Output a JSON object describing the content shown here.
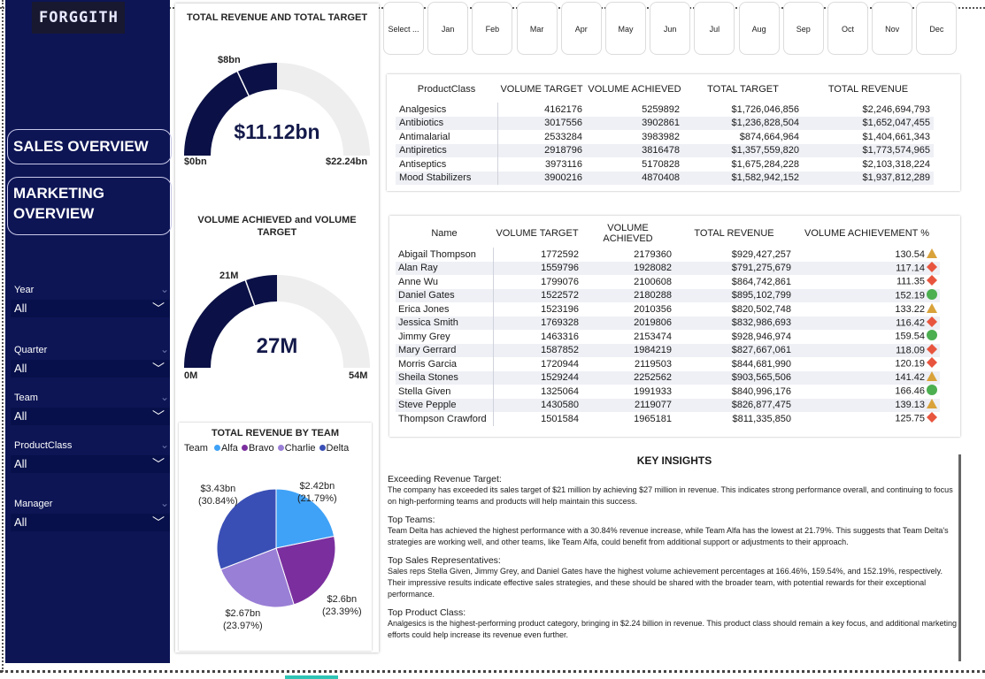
{
  "app": {
    "logo_text": "FORGGITH"
  },
  "nav": {
    "sales": "SALES OVERVIEW",
    "marketing": "MARKETING OVERVIEW"
  },
  "filters": [
    {
      "label": "Year",
      "value": "All"
    },
    {
      "label": "Quarter",
      "value": "All"
    },
    {
      "label": "Team",
      "value": "All"
    },
    {
      "label": "ProductClass",
      "value": "All"
    },
    {
      "label": "Manager",
      "value": "All"
    }
  ],
  "months": [
    "Select ...",
    "Jan",
    "Feb",
    "Mar",
    "Apr",
    "May",
    "Jun",
    "Jul",
    "Aug",
    "Sep",
    "Oct",
    "Nov",
    "Dec"
  ],
  "gauge1": {
    "title": "TOTAL REVENUE AND TOTAL TARGET",
    "value": "$11.12bn",
    "min": "$0bn",
    "max": "$22.24bn",
    "target": "$8bn",
    "fraction": 0.5,
    "target_fraction": 0.36
  },
  "gauge2": {
    "title": "VOLUME ACHIEVED and VOLUME TARGET",
    "value": "27M",
    "min": "0M",
    "max": "54M",
    "target": "21M",
    "fraction": 0.5,
    "target_fraction": 0.39
  },
  "pie": {
    "title": "TOTAL REVENUE BY TEAM",
    "legend_title": "Team",
    "labels": [
      {
        "value": "$2.42bn",
        "pct": "(21.79%)"
      },
      {
        "value": "$2.6bn",
        "pct": "(23.39%)"
      },
      {
        "value": "$2.67bn",
        "pct": "(23.97%)"
      },
      {
        "value": "$3.43bn",
        "pct": "(30.84%)"
      }
    ]
  },
  "chart_data": {
    "type": "pie",
    "title": "TOTAL REVENUE BY TEAM",
    "categories": [
      "Alfa",
      "Bravo",
      "Charlie",
      "Delta"
    ],
    "values": [
      2.42,
      2.6,
      2.67,
      3.43
    ],
    "percentages": [
      21.79,
      23.39,
      23.97,
      30.84
    ],
    "colors": [
      "#3fa2f7",
      "#7b2f9e",
      "#9a7fd6",
      "#3a4fb5"
    ]
  },
  "product_table": {
    "headers": [
      "ProductClass",
      "VOLUME TARGET",
      "VOLUME ACHIEVED",
      "TOTAL TARGET",
      "TOTAL REVENUE"
    ],
    "rows": [
      [
        "Analgesics",
        "4162176",
        "5259892",
        "$1,726,046,856",
        "$2,246,694,793"
      ],
      [
        "Antibiotics",
        "3017556",
        "3902861",
        "$1,236,828,504",
        "$1,652,047,455"
      ],
      [
        "Antimalarial",
        "2533284",
        "3983982",
        "$874,664,964",
        "$1,404,661,343"
      ],
      [
        "Antipiretics",
        "2918796",
        "3816478",
        "$1,357,559,820",
        "$1,773,574,965"
      ],
      [
        "Antiseptics",
        "3973116",
        "5170828",
        "$1,675,284,228",
        "$2,103,318,224"
      ],
      [
        "Mood Stabilizers",
        "3900216",
        "4870408",
        "$1,582,942,152",
        "$1,937,812,289"
      ]
    ]
  },
  "rep_table": {
    "headers": [
      "Name",
      "VOLUME TARGET",
      "VOLUME ACHIEVED",
      "TOTAL REVENUE",
      "VOLUME ACHIEVEMENT %"
    ],
    "rows": [
      [
        "Abigail Thompson",
        "1772592",
        "2179360",
        "$929,427,257",
        "130.54",
        "triangle"
      ],
      [
        "Alan Ray",
        "1559796",
        "1928082",
        "$791,275,679",
        "117.14",
        "diamond"
      ],
      [
        "Anne Wu",
        "1799076",
        "2100608",
        "$864,742,861",
        "111.35",
        "diamond"
      ],
      [
        "Daniel Gates",
        "1522572",
        "2180288",
        "$895,102,799",
        "152.19",
        "circle"
      ],
      [
        "Erica Jones",
        "1523196",
        "2010356",
        "$820,502,748",
        "133.22",
        "triangle"
      ],
      [
        "Jessica Smith",
        "1769328",
        "2019806",
        "$832,986,693",
        "116.42",
        "diamond"
      ],
      [
        "Jimmy Grey",
        "1463316",
        "2153474",
        "$928,946,974",
        "159.54",
        "circle"
      ],
      [
        "Mary Gerrard",
        "1587852",
        "1984219",
        "$827,667,061",
        "118.09",
        "diamond"
      ],
      [
        "Morris Garcia",
        "1720944",
        "2119503",
        "$844,681,990",
        "120.19",
        "diamond"
      ],
      [
        "Sheila Stones",
        "1529244",
        "2252562",
        "$903,565,506",
        "141.42",
        "triangle"
      ],
      [
        "Stella Given",
        "1325064",
        "1991933",
        "$840,996,176",
        "166.46",
        "circle"
      ],
      [
        "Steve Pepple",
        "1430580",
        "2119077",
        "$826,877,475",
        "139.13",
        "triangle"
      ],
      [
        "Thompson Crawford",
        "1501584",
        "1965181",
        "$811,335,850",
        "125.75",
        "diamond"
      ]
    ]
  },
  "insights": {
    "title": "KEY INSIGHTS",
    "items": [
      {
        "head": "Exceeding Revenue Target:",
        "body": "The company has exceeded its sales target of $21 million by achieving $27 million in revenue. This indicates strong performance overall, and continuing to focus on high-performing teams and products will help maintain this success."
      },
      {
        "head": "Top Teams:",
        "body": "Team Delta has achieved the highest performance with a 30.84% revenue increase, while Team Alfa has the lowest at 21.79%. This suggests that Team Delta's strategies are working well, and other teams, like Team Alfa, could benefit from additional support or adjustments to their approach."
      },
      {
        "head": "Top Sales Representatives:",
        "body": "Sales reps Stella Given, Jimmy Grey, and Daniel Gates have the highest volume achievement percentages at 166.46%, 159.54%, and 152.19%, respectively. Their impressive results indicate effective sales strategies, and these should be shared with the broader team, with potential rewards for their exceptional performance."
      },
      {
        "head": "Top Product Class:",
        "body": "Analgesics is the highest-performing product category, bringing in $2.24 billion in revenue. This product class should remain a key focus, and additional marketing efforts could help increase its revenue even further."
      }
    ]
  },
  "colors": {
    "navy": "#0d1555",
    "gauge_fill": "#0b1146",
    "gauge_bg": "#efeeee",
    "triangle": "#d9a23a",
    "diamond": "#e8553e",
    "circle": "#4caf50"
  }
}
